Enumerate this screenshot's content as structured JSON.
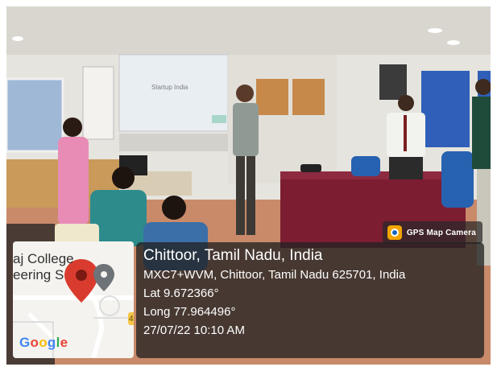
{
  "gps_tag": {
    "label": "GPS Map Camera",
    "icon": "gps-map-camera-icon"
  },
  "map": {
    "fragment_line1": "aj College",
    "fragment_line2": "eering S",
    "road_number": "4",
    "logo_text": "Google",
    "logo_letters": [
      {
        "char": "G",
        "color": "#4285F4"
      },
      {
        "char": "o",
        "color": "#EA4335"
      },
      {
        "char": "o",
        "color": "#FBBC05"
      },
      {
        "char": "g",
        "color": "#4285F4"
      },
      {
        "char": "l",
        "color": "#34A853"
      },
      {
        "char": "e",
        "color": "#EA4335"
      }
    ],
    "pin_color": "#d93c2f"
  },
  "location": {
    "title": "Chittoor, Tamil Nadu, India",
    "address": "MXC7+WVM, Chittoor, Tamil Nadu 625701, India",
    "lat": "Lat 9.672366°",
    "long": "Long 77.964496°",
    "datetime": "27/07/22 10:10 AM"
  },
  "screen": {
    "text": "Startup India"
  }
}
